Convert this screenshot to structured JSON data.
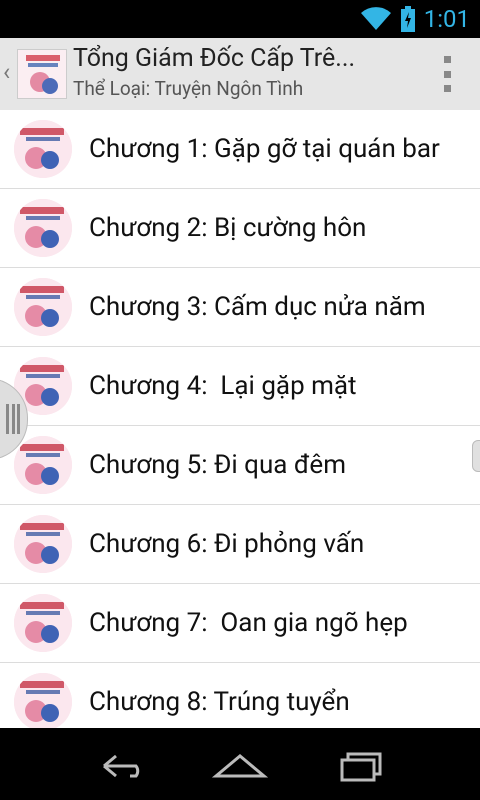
{
  "status": {
    "time": "1:01",
    "accent": "#33b5e5"
  },
  "action_bar": {
    "title": "Tổng Giám Đốc Cấp Trê...",
    "subtitle": "Thể Loại: Truyện Ngôn Tình",
    "up_icon": "chevron-left-icon",
    "overflow_icon": "overflow-menu-icon"
  },
  "chapters": [
    {
      "label": "Chương 1: Gặp gỡ tại quán bar"
    },
    {
      "label": "Chương 2: Bị cường hôn"
    },
    {
      "label": "Chương 3: Cấm dục nửa năm"
    },
    {
      "label": "Chương 4:  Lại gặp mặt"
    },
    {
      "label": "Chương 5: Đi qua đêm"
    },
    {
      "label": "Chương 6: Đi phỏng vấn"
    },
    {
      "label": "Chương 7:  Oan gia ngõ hẹp"
    },
    {
      "label": "Chương 8: Trúng tuyển"
    }
  ],
  "nav": {
    "back_icon": "back-icon",
    "home_icon": "home-icon",
    "recents_icon": "recents-icon"
  }
}
